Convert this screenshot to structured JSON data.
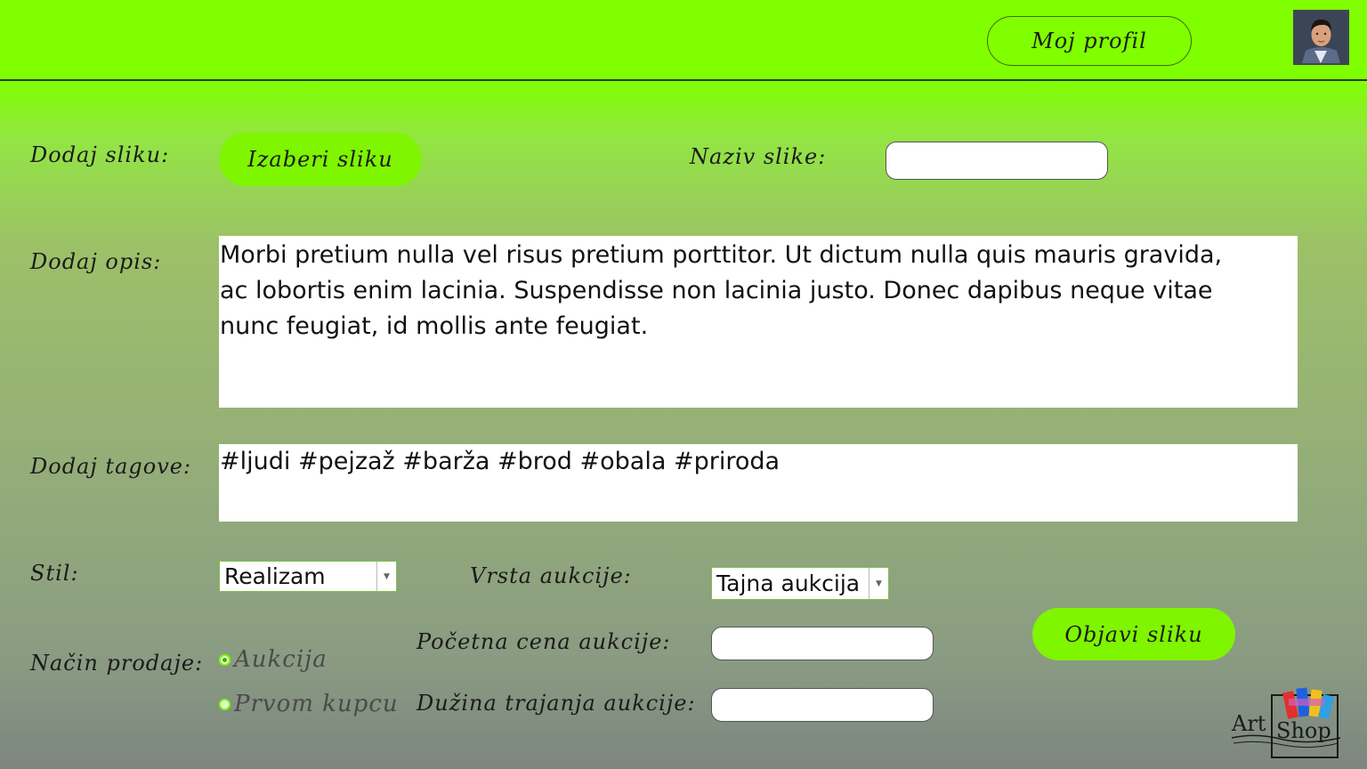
{
  "header": {
    "profile_button": "Moj profil"
  },
  "form": {
    "add_image_label": "Dodaj sliku:",
    "choose_image_button": "Izaberi sliku",
    "image_name_label": "Naziv slike:",
    "image_name_value": "",
    "description_label": "Dodaj opis:",
    "description_value": "Morbi pretium nulla vel risus pretium porttitor. Ut dictum nulla quis mauris gravida, ac lobortis enim lacinia. Suspendisse non lacinia justo. Donec dapibus neque vitae nunc feugiat, id mollis ante feugiat.",
    "tags_label": "Dodaj tagove:",
    "tags_value": "#ljudi #pejzaž #barža #brod #obala #priroda",
    "style_label": "Stil:",
    "style_value": "Realizam",
    "auction_type_label": "Vrsta aukcije:",
    "auction_type_value": "Tajna aukcija",
    "sale_method_label": "Način prodaje:",
    "sale_options": [
      {
        "label": "Aukcija",
        "checked": true
      },
      {
        "label": "Prvom kupcu",
        "checked": false
      }
    ],
    "start_price_label": "Početna cena aukcije:",
    "start_price_value": "",
    "duration_label": "Dužina trajanja aukcije:",
    "duration_value": "",
    "publish_button": "Objavi sliku"
  },
  "logo": {
    "text_left": "Art",
    "text_right": "Shop"
  },
  "colors": {
    "accent": "#80ff00",
    "button": "#7ff500"
  }
}
